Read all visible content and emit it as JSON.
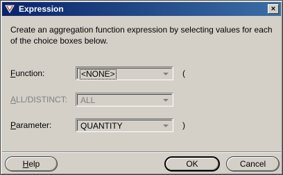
{
  "window": {
    "title": "Expression",
    "icon": "app-icon",
    "close_label": "×"
  },
  "intro": "Create an aggregation function expression by selecting values for each of the choice boxes below.",
  "fields": {
    "function": {
      "label_mnemonic": "F",
      "label_rest": "unction:",
      "value": "<NONE>",
      "suffix": "("
    },
    "all_distinct": {
      "label_mnemonic": "A",
      "label_rest": "LL/DISTINCT:",
      "value": "ALL",
      "disabled": true
    },
    "parameter": {
      "label_mnemonic": "P",
      "label_rest": "arameter:",
      "value": "QUANTITY",
      "suffix": ")"
    }
  },
  "buttons": {
    "help_mnemonic": "H",
    "help_rest": "elp",
    "ok": "OK",
    "cancel": "Cancel"
  },
  "colors": {
    "dialog_bg": "#d4d0c8",
    "title_start": "#0a246a",
    "title_end": "#3a6ea5"
  }
}
